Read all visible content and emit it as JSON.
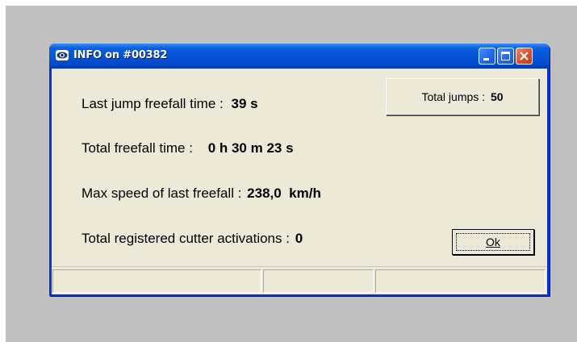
{
  "window": {
    "title": "INFO on #00382",
    "icon": "app-eye-icon",
    "controls": [
      "minimize-icon",
      "maximize-icon",
      "close-icon"
    ]
  },
  "info": {
    "last_jump_label": "Last jump freefall time :",
    "last_jump_value": "39 s",
    "total_freefall_label": "Total freefall time :",
    "total_freefall_value": "0 h 30 m 23 s",
    "max_speed_label": "Max speed of last freefall :",
    "max_speed_value": "238,0  km/h",
    "cutter_label": "Total registered cutter activations :",
    "cutter_value": "0"
  },
  "total_jumps": {
    "label": "Total jumps :",
    "value": "50"
  },
  "ok_button": {
    "label": "Ok"
  },
  "status_bar": {
    "panels": [
      "",
      "",
      ""
    ]
  },
  "colors": {
    "titlebar": "#0655d6",
    "client_bg": "#ece9d8",
    "desktop_bg": "#c0c0c0",
    "close_button": "#d6522c"
  }
}
